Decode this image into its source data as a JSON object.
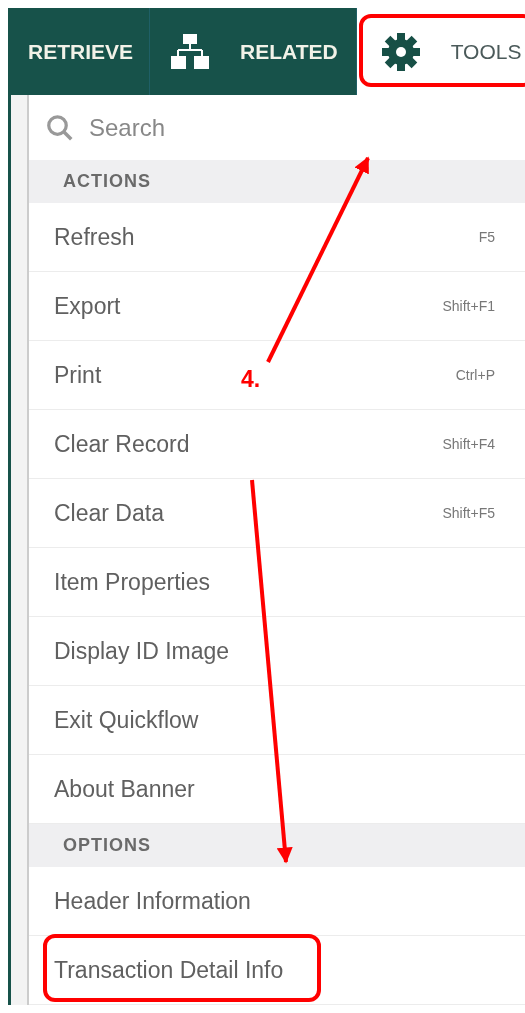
{
  "tabs": [
    {
      "label": "RETRIEVE",
      "kind": "text",
      "selected": false,
      "highlighted": false
    },
    {
      "label": "RELATED",
      "kind": "hierarchy",
      "selected": false,
      "highlighted": false
    },
    {
      "label": "TOOLS",
      "kind": "gear",
      "selected": true,
      "highlighted": true
    }
  ],
  "search": {
    "placeholder": "Search"
  },
  "sections": [
    {
      "title": "ACTIONS",
      "items": [
        {
          "label": "Refresh",
          "shortcut": "F5",
          "highlighted": false
        },
        {
          "label": "Export",
          "shortcut": "Shift+F1",
          "highlighted": false
        },
        {
          "label": "Print",
          "shortcut": "Ctrl+P",
          "highlighted": false
        },
        {
          "label": "Clear Record",
          "shortcut": "Shift+F4",
          "highlighted": false
        },
        {
          "label": "Clear Data",
          "shortcut": "Shift+F5",
          "highlighted": false
        },
        {
          "label": "Item Properties",
          "highlighted": false
        },
        {
          "label": "Display ID Image",
          "highlighted": false
        },
        {
          "label": "Exit Quickflow",
          "highlighted": false
        },
        {
          "label": "About Banner",
          "highlighted": false
        }
      ]
    },
    {
      "title": "OPTIONS",
      "items": [
        {
          "label": "Header Information",
          "highlighted": false
        },
        {
          "label": "Transaction Detail Info",
          "highlighted": true
        }
      ]
    }
  ],
  "annotation": {
    "label": "4."
  }
}
